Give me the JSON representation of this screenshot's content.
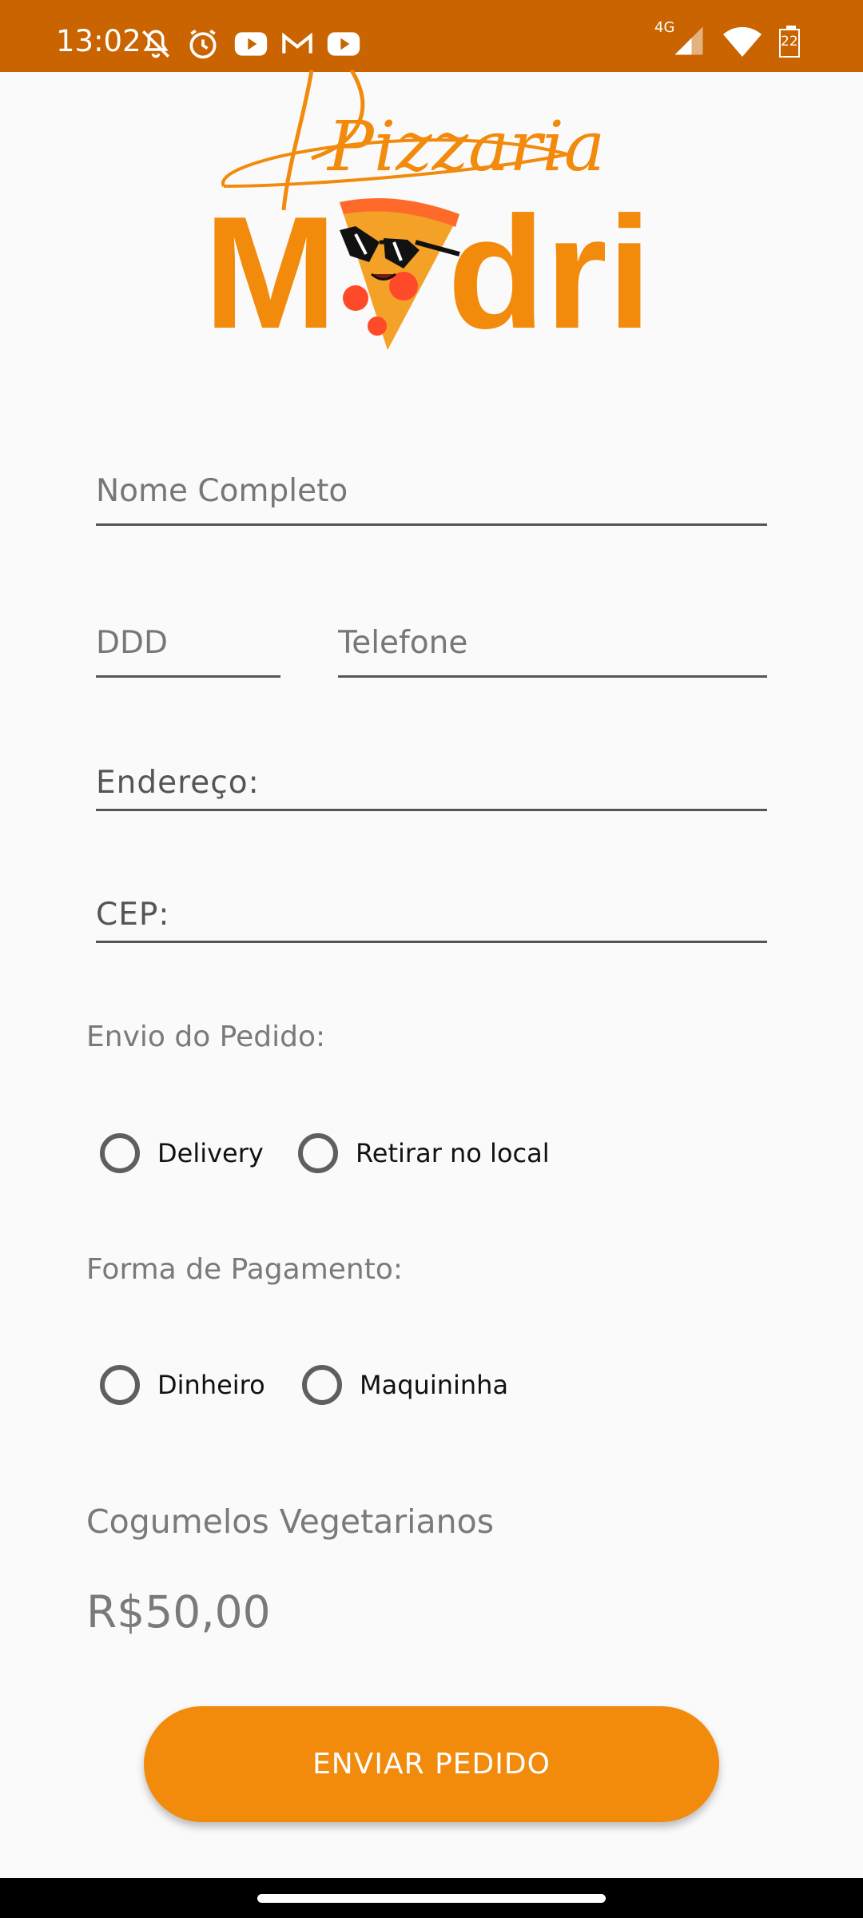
{
  "status_bar": {
    "time": "13:02",
    "network": "4G",
    "battery": "22"
  },
  "logo": {
    "script_text": "Pizzaria",
    "brand_text_left": "M",
    "brand_text_right": "dri",
    "color": "#f28a0c"
  },
  "form": {
    "name_placeholder": "Nome Completo",
    "ddd_placeholder": "DDD",
    "phone_placeholder": "Telefone",
    "address_label": "Endereço:",
    "cep_label": "CEP:"
  },
  "delivery": {
    "label": "Envio do Pedido:",
    "options": [
      "Delivery",
      "Retirar no local"
    ]
  },
  "payment": {
    "label": "Forma de Pagamento:",
    "options": [
      "Dinheiro",
      "Maquininha"
    ]
  },
  "product": {
    "name": "Cogumelos Vegetarianos",
    "price": "R$50,00"
  },
  "submit_label": "ENVIAR PEDIDO",
  "colors": {
    "status_bar": "#c96400",
    "accent": "#f28a0c"
  }
}
